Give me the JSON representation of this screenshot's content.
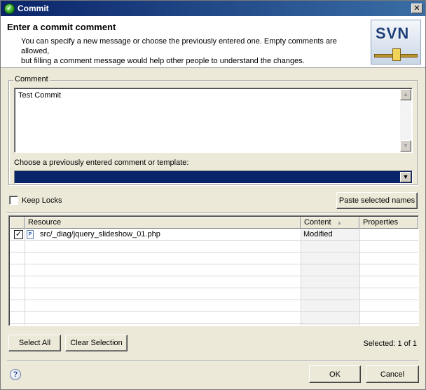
{
  "window": {
    "title": "Commit",
    "close_glyph": "✕"
  },
  "header": {
    "title": "Enter a commit comment",
    "description_line1": "You can specify a new message or choose the previously entered one. Empty comments are allowed,",
    "description_line2": "but filling a comment message would help other people to understand the changes.",
    "logo_text": "SVN"
  },
  "comment": {
    "group_label": "Comment",
    "value": "Test Commit",
    "choose_label": "Choose a previously entered comment or template:",
    "template_selected": ""
  },
  "options": {
    "keep_locks_label": "Keep Locks",
    "keep_locks_checked": false,
    "paste_button": "Paste selected names"
  },
  "table": {
    "columns": [
      "Resource",
      "Content",
      "Properties"
    ],
    "rows": [
      {
        "checked": true,
        "resource": "src/_diag/jquery_slideshow_01.php",
        "content": "Modified",
        "properties": ""
      }
    ]
  },
  "selection": {
    "select_all": "Select All",
    "clear_selection": "Clear Selection",
    "status": "Selected: 1 of 1"
  },
  "footer": {
    "ok": "OK",
    "cancel": "Cancel",
    "help_glyph": "?"
  },
  "colors": {
    "title_bar": "#0a246a",
    "dialog_bg": "#ece9d8",
    "combo_selected": "#0a246a"
  }
}
